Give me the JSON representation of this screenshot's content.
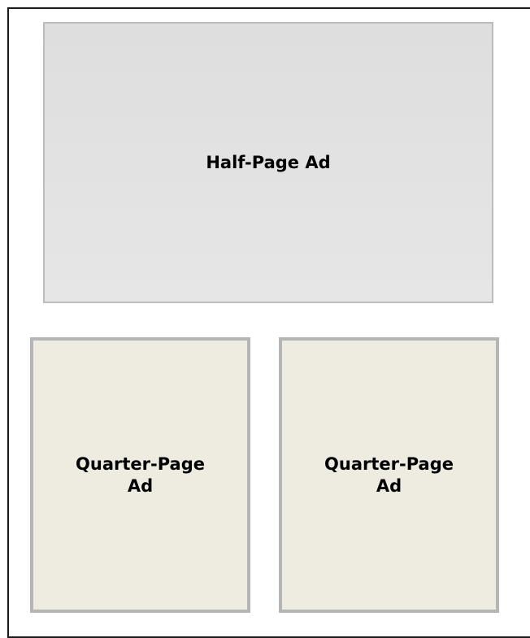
{
  "layout": {
    "half_page": {
      "label": "Half-Page Ad",
      "color": "#e2e2e2"
    },
    "quarter_pages": [
      {
        "label": "Quarter-Page\nAd",
        "color": "#eeebe1"
      },
      {
        "label": "Quarter-Page\nAd",
        "color": "#eeebe1"
      }
    ]
  }
}
